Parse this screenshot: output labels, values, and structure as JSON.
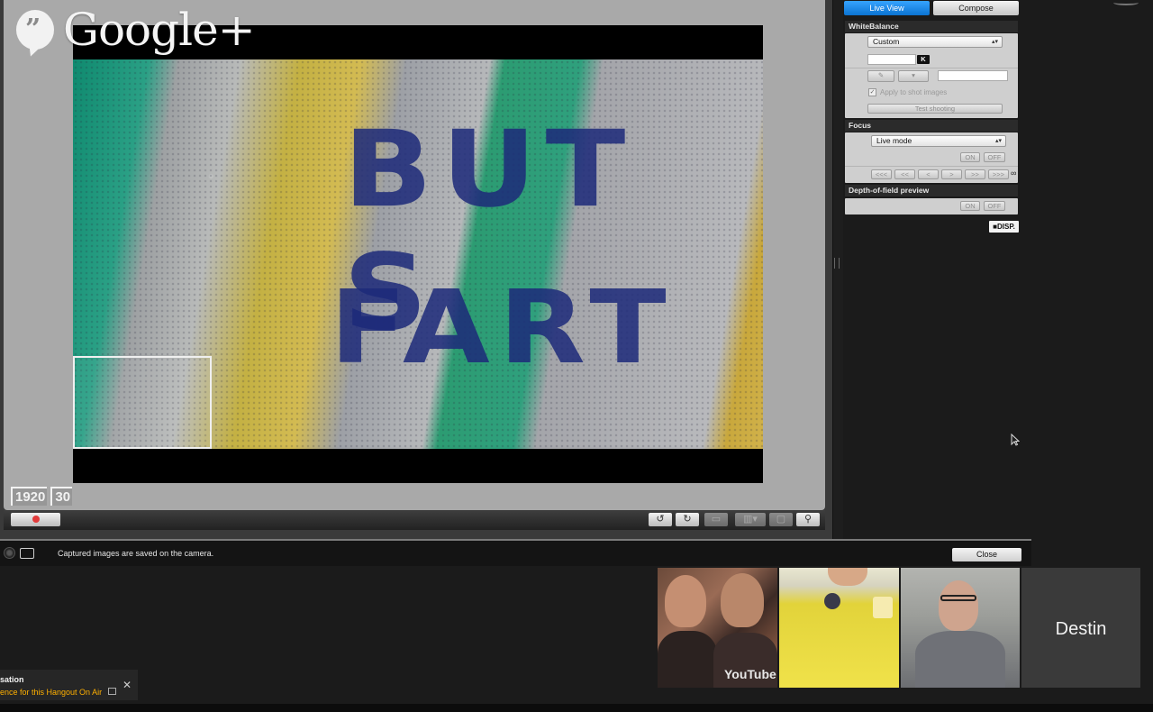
{
  "header": {
    "logo_text": "Google+"
  },
  "viewer": {
    "pavement_line1": "BUT S",
    "pavement_line2": "FART",
    "resolution_badge": "1920",
    "framerate_badge": "30"
  },
  "panel": {
    "tabs": {
      "live_view": "Live View",
      "compose": "Compose"
    },
    "white_balance": {
      "title": "WhiteBalance",
      "mode": "Custom",
      "kelvin_button": "K",
      "apply_label": "Apply to shot images",
      "test_button": "Test shooting"
    },
    "focus": {
      "title": "Focus",
      "mode": "Live mode",
      "on": "ON",
      "off": "OFF",
      "steps": [
        "<<<",
        "<<",
        "<",
        ">",
        ">>",
        ">>>"
      ],
      "infinity": "∞"
    },
    "dof": {
      "title": "Depth-of-field preview",
      "on": "ON",
      "off": "OFF"
    },
    "disp_button": "DISP."
  },
  "status": {
    "message": "Captured images are saved on the camera.",
    "close_button": "Close"
  },
  "hangout": {
    "participants": [
      {
        "name": "",
        "shirt_text": "YouTube"
      },
      {
        "name": ""
      },
      {
        "name": ""
      },
      {
        "name": "Destin"
      }
    ]
  },
  "notice": {
    "title": "sation",
    "body": "ence for this Hangout On Air",
    "close": "✕"
  },
  "colors": {
    "accent_tab": "#0b73d1",
    "record_dot": "#e23b3b",
    "notice_text": "#ffb000"
  }
}
